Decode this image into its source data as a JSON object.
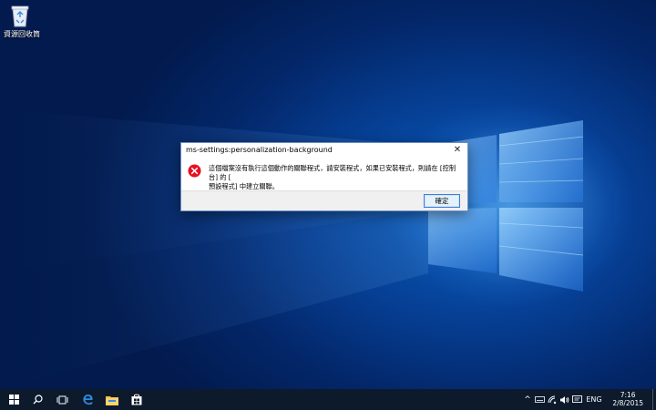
{
  "desktop": {
    "recycle_bin_label": "資源回收筒"
  },
  "dialog": {
    "title": "ms-settings:personalization-background",
    "message_line1": "這個檔案沒有執行這個動作的關聯程式，請安裝程式，如果已安裝程式，則請在 [控制台] 的 [",
    "message_line2": "預設程式] 中建立關聯。",
    "ok_label": "確定",
    "close_label": "✕",
    "icon": "error-icon"
  },
  "taskbar": {
    "items": [
      "start-icon",
      "search-icon",
      "task-view-icon",
      "edge-icon",
      "file-explorer-icon",
      "store-icon"
    ],
    "tray": {
      "chevron": "^",
      "language": "ENG",
      "time": "7:16",
      "date": "2/8/2015"
    }
  },
  "colors": {
    "desktop_blue": "#063f94",
    "taskbar": "#0c1a2c",
    "error_red": "#e81123",
    "button_border": "#3c7fd6"
  }
}
